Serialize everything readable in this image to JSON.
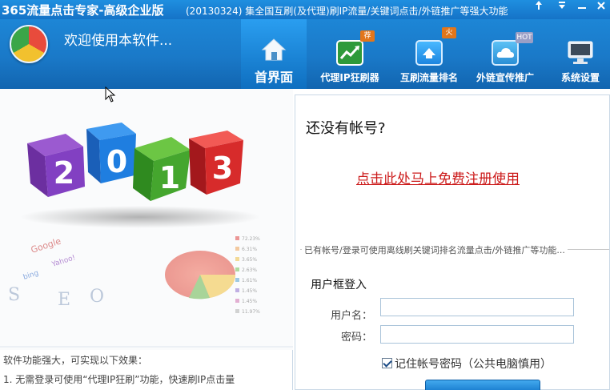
{
  "titlebar": {
    "title": "365流量点击专家-高级企业版",
    "subtitle": "(20130324) 集全国互刷(及代理)刷IP流量/关键词点击/外链推广等强大功能",
    "pin_icon": "pin-icon",
    "dropdown_icon": "chevron-down-icon",
    "minimize_icon": "minimize-icon",
    "close_icon": "close-icon"
  },
  "header": {
    "welcome": "欢迎使用本软件...",
    "tabs": [
      {
        "label": "首界面",
        "icon": "home-icon",
        "active": true
      },
      {
        "label": "代理IP狂刷器",
        "icon": "chart-icon",
        "badge": "荐",
        "badge_color": "#e2761b"
      },
      {
        "label": "互刷流量排名",
        "icon": "cursor-arrow-icon",
        "badge": "火",
        "badge_color": "#e2761b"
      },
      {
        "label": "外链宣传推广",
        "icon": "cloud-icon",
        "badge": "HOT",
        "badge_color": "#9a9fc6"
      },
      {
        "label": "系统设置",
        "icon": "monitor-icon"
      }
    ]
  },
  "left": {
    "cube_digits": [
      "2",
      "0",
      "1",
      "3"
    ],
    "seo_letters": [
      "S",
      "E",
      "O"
    ],
    "brand_labels": [
      "Google",
      "Yahoo!",
      "bing"
    ],
    "stats": [
      "72.23%",
      "6.31%",
      "3.65%",
      "2.63%",
      "1.61%",
      "1.45%",
      "1.45%",
      "11.97%"
    ],
    "intro": "软件功能强大，可实现以下效果：",
    "point1": "1. 无需登录可使用“代理IP狂刷”功能，快速刷IP点击量"
  },
  "right": {
    "no_account": "还没有帐号?",
    "register_link": "点击此处马上免费注册使用",
    "legend": "已有帐号/登录可使用离线刷关键词排名流量点击/外链推广等功能...",
    "login_title": "用户框登入",
    "username_label": "用户名：",
    "username_value": "",
    "password_label": "密码：",
    "password_value": "",
    "remember_label": "记住帐号密码（公共电脑慎用）",
    "remember_checked": true
  },
  "colors": {
    "title_bar": "#1f8fe0",
    "header": "#1a79c8",
    "active_tab": "#2a9ef0",
    "register_link": "#cc1b1b"
  }
}
